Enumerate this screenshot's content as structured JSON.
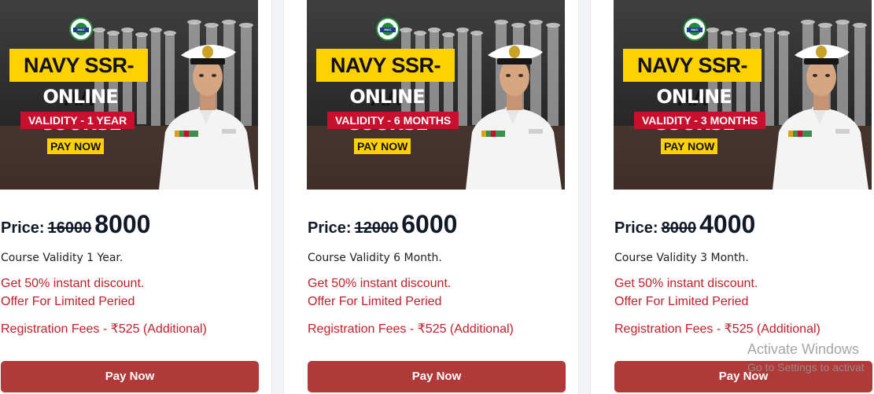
{
  "cards": [
    {
      "banner": {
        "logo_text": "MAC",
        "title": "NAVY SSR-AA",
        "subtitle": "ONLINE COURSE",
        "validity": "VALIDITY - 1 YEAR",
        "badge": "PAY NOW"
      },
      "price_label": "Price:",
      "price_old": "16000",
      "price_new": "8000",
      "validity_text": "Course Validity 1 Year.",
      "discount": "Get 50% instant discount.",
      "offer": "Offer For Limited Peried",
      "registration": "Registration Fees - ₹525 (Additional)",
      "button": "Pay Now"
    },
    {
      "banner": {
        "logo_text": "MAC",
        "title": "NAVY SSR-AA",
        "subtitle": "ONLINE COURSE",
        "validity": "VALIDITY - 6 MONTHS",
        "badge": "PAY NOW"
      },
      "price_label": "Price:",
      "price_old": "12000",
      "price_new": "6000",
      "validity_text": "Course Validity 6 Month.",
      "discount": "Get 50% instant discount.",
      "offer": "Offer For Limited Peried",
      "registration": "Registration Fees - ₹525 (Additional)",
      "button": "Pay Now"
    },
    {
      "banner": {
        "logo_text": "MAC",
        "title": "NAVY SSR-AA",
        "subtitle": "ONLINE COURSE",
        "validity": "VALIDITY - 3 MONTHS",
        "badge": "PAY NOW"
      },
      "price_label": "Price:",
      "price_old": "8000",
      "price_new": "4000",
      "validity_text": "Course Validity 3 Month.",
      "discount": "Get 50% instant discount.",
      "offer": "Offer For Limited Peried",
      "registration": "Registration Fees - ₹525 (Additional)",
      "button": "Pay Now"
    }
  ],
  "watermark": {
    "line1": "Activate Windows",
    "line2": "Go to Settings to activat"
  },
  "colors": {
    "button": "#b03a3a",
    "offer_text": "#c41e2a",
    "banner_yellow": "#ffd100",
    "banner_red": "#c8102e"
  }
}
